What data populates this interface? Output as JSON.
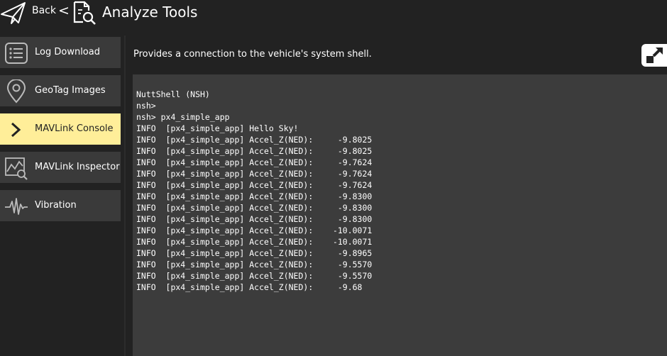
{
  "header": {
    "back_label": "Back",
    "separator": "<",
    "title": "Analyze Tools",
    "icons": {
      "back": "paper-plane-icon",
      "page": "document-search-icon"
    }
  },
  "sidebar": {
    "items": [
      {
        "label": "Log Download",
        "icon": "list-icon",
        "active": false
      },
      {
        "label": "GeoTag Images",
        "icon": "map-pin-icon",
        "active": false
      },
      {
        "label": "MAVLink Console",
        "icon": "chevron-right-icon",
        "active": true
      },
      {
        "label": "MAVLink Inspector",
        "icon": "chart-inspect-icon",
        "active": false
      },
      {
        "label": "Vibration",
        "icon": "waveform-icon",
        "active": false
      }
    ]
  },
  "main": {
    "description": "Provides a connection to the vehicle's system shell.",
    "popout_icon": "popout-icon"
  },
  "console": {
    "lines": [
      "NuttShell (NSH)",
      "nsh>",
      "nsh> px4_simple_app",
      "INFO  [px4_simple_app] Hello Sky!",
      "INFO  [px4_simple_app] Accel_Z(NED):     -9.8025",
      "INFO  [px4_simple_app] Accel_Z(NED):     -9.8025",
      "INFO  [px4_simple_app] Accel_Z(NED):     -9.7624",
      "INFO  [px4_simple_app] Accel_Z(NED):     -9.7624",
      "INFO  [px4_simple_app] Accel_Z(NED):     -9.7624",
      "INFO  [px4_simple_app] Accel_Z(NED):     -9.8300",
      "INFO  [px4_simple_app] Accel_Z(NED):     -9.8300",
      "INFO  [px4_simple_app] Accel_Z(NED):     -9.8300",
      "INFO  [px4_simple_app] Accel_Z(NED):    -10.0071",
      "INFO  [px4_simple_app] Accel_Z(NED):    -10.0071",
      "INFO  [px4_simple_app] Accel_Z(NED):     -9.8965",
      "INFO  [px4_simple_app] Accel_Z(NED):     -9.5570",
      "INFO  [px4_simple_app] Accel_Z(NED):     -9.5570",
      "INFO  [px4_simple_app] Accel_Z(NED):     -9.68"
    ]
  },
  "colors": {
    "background": "#222222",
    "sidebar_item": "#3a3a3a",
    "active_item": "#ffee99",
    "console_bg": "#3c3c3c",
    "text": "#ffffff"
  }
}
